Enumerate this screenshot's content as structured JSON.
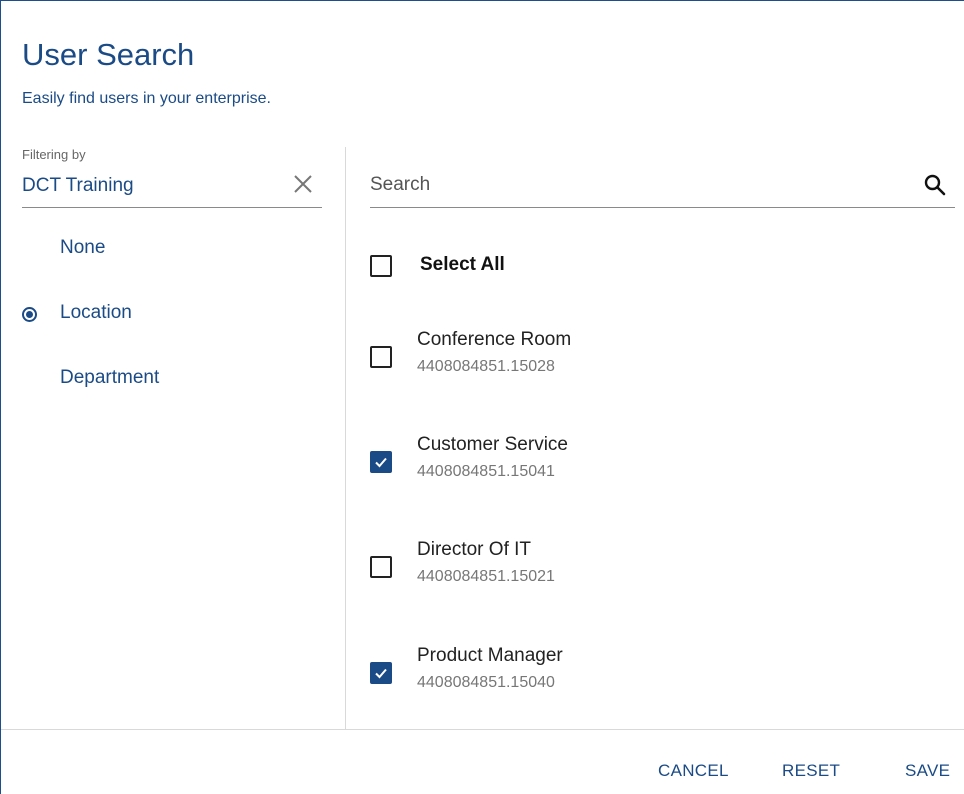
{
  "dialog": {
    "title": "User Search",
    "subtitle": "Easily find users in your enterprise."
  },
  "filter": {
    "label": "Filtering by",
    "value": "DCT Training",
    "clear_icon": "close-icon",
    "options": [
      {
        "label": "None",
        "selected": false
      },
      {
        "label": "Location",
        "selected": true
      },
      {
        "label": "Department",
        "selected": false
      }
    ]
  },
  "search": {
    "placeholder": "Search",
    "value": "",
    "icon": "search-icon"
  },
  "select_all": {
    "label": "Select All",
    "checked": false
  },
  "users": [
    {
      "name": "Conference Room",
      "id": "4408084851.15028",
      "checked": false
    },
    {
      "name": "Customer Service",
      "id": "4408084851.15041",
      "checked": true
    },
    {
      "name": "Director Of IT",
      "id": "4408084851.15021",
      "checked": false
    },
    {
      "name": "Product Manager",
      "id": "4408084851.15040",
      "checked": true
    }
  ],
  "footer": {
    "cancel_label": "CANCEL",
    "reset_label": "RESET",
    "save_label": "SAVE"
  },
  "colors": {
    "accent": "#1b4b86",
    "divider": "#d9d9d9"
  }
}
